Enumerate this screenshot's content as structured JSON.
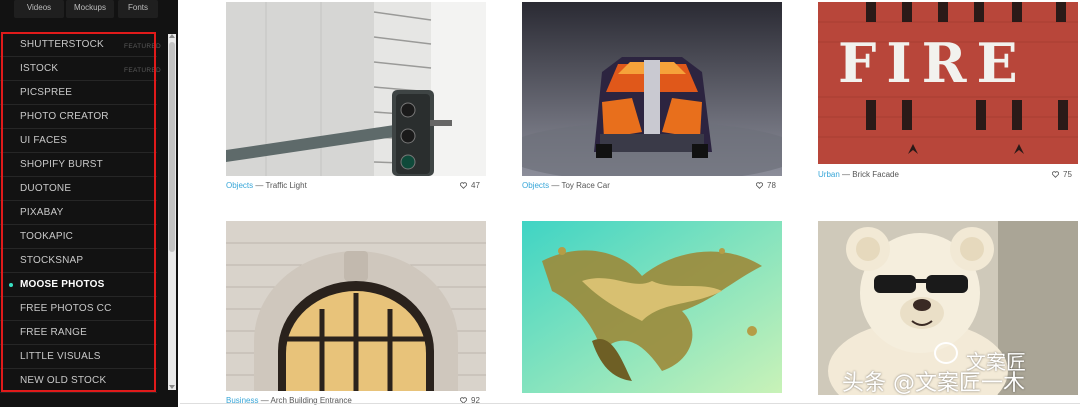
{
  "top_tabs": [
    "Videos",
    "Mockups",
    "Fonts"
  ],
  "sidebar": {
    "items": [
      {
        "label": "SHUTTERSTOCK",
        "badge": "FEATURED"
      },
      {
        "label": "ISTOCK",
        "badge": "FEATURED"
      },
      {
        "label": "PICSPREE"
      },
      {
        "label": "PHOTO CREATOR"
      },
      {
        "label": "UI FACES"
      },
      {
        "label": "SHOPIFY BURST"
      },
      {
        "label": "DUOTONE"
      },
      {
        "label": "PIXABAY"
      },
      {
        "label": "TOOKAPIC"
      },
      {
        "label": "STOCKSNAP"
      },
      {
        "label": "MOOSE PHOTOS",
        "active": true
      },
      {
        "label": "FREE PHOTOS CC"
      },
      {
        "label": "FREE RANGE"
      },
      {
        "label": "LITTLE VISUALS"
      },
      {
        "label": "NEW OLD STOCK"
      }
    ]
  },
  "cards": [
    {
      "category": "Objects",
      "title": "Traffic Light",
      "likes": "47",
      "image": "traffic-light-photo"
    },
    {
      "category": "Objects",
      "title": "Toy Race Car",
      "likes": "78",
      "image": "toy-race-car-photo"
    },
    {
      "category": "Urban",
      "title": "Brick Facade",
      "likes": "75",
      "image": "brick-facade-photo"
    },
    {
      "category": "Business",
      "title": "Arch Building Entrance",
      "likes": "92",
      "image": "arch-building-photo"
    },
    {
      "category": "",
      "title": "",
      "likes": "",
      "image": "liquid-gold-splash-photo"
    },
    {
      "category": "",
      "title": "",
      "likes": "",
      "image": "teddy-bear-photo"
    }
  ],
  "photo_text": {
    "brick_sign": "FIRE"
  },
  "watermark": {
    "line1": "文案匠",
    "line2": "头条 @文案匠一木"
  },
  "colors": {
    "accent": "#38e0c2",
    "link": "#37a6d8",
    "highlight_box": "#e01a1a"
  }
}
